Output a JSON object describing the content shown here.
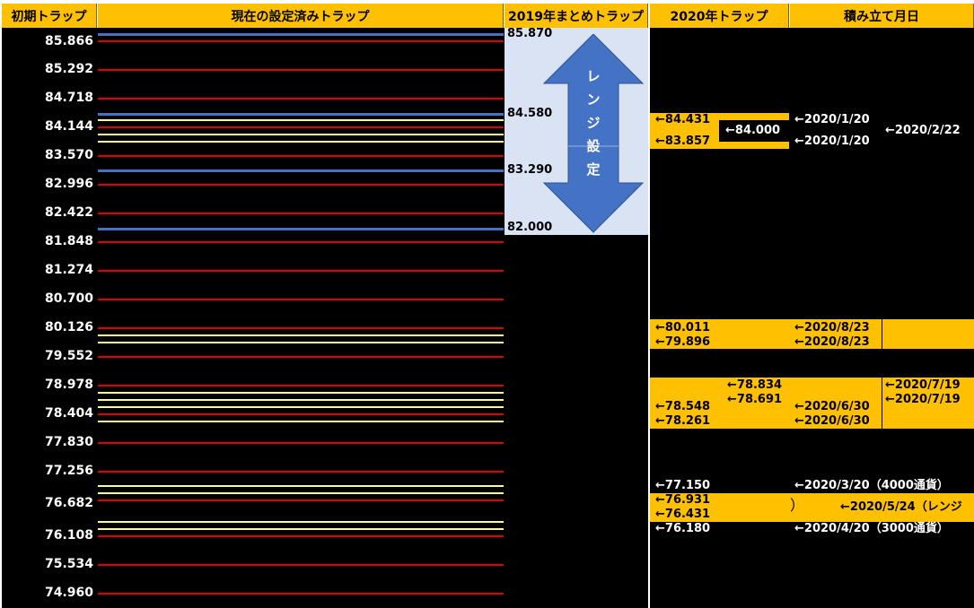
{
  "headers": {
    "col1": "初期トラップ",
    "col2": "現在の設定済みトラップ",
    "col3": "2019年まとめトラップ",
    "col4": "2020年トラップ",
    "col5": "積み立て月日"
  },
  "initial_prices": [
    "85.866",
    "85.292",
    "84.718",
    "84.144",
    "83.570",
    "82.996",
    "82.422",
    "81.848",
    "81.274",
    "80.700",
    "80.126",
    "79.552",
    "78.978",
    "78.404",
    "77.830",
    "77.256",
    "76.682",
    "76.108",
    "75.534",
    "74.960"
  ],
  "range_2019": {
    "values": [
      "85.870",
      "84.580",
      "83.290",
      "82.000"
    ],
    "arrow_label": "レンジ設定",
    "colors": {
      "panel": "#dae3f3",
      "arrow": "#4472c4"
    }
  },
  "traps_2020": {
    "group1": {
      "a": "←84.431",
      "b": "←83.857",
      "box": "←84.000",
      "d1": "←2020/1/20",
      "d2": "←2020/1/20",
      "d3": "←2020/2/22"
    },
    "group2": {
      "a": "←80.011",
      "b": "←79.896",
      "d1": "←2020/8/23",
      "d2": "←2020/8/23"
    },
    "group3": {
      "a": "←78.834",
      "b": "←78.691",
      "c": "←78.548",
      "d": "←78.261",
      "d1": "←2020/7/19",
      "d2": "←2020/7/19",
      "d3": "←2020/6/30",
      "d4": "←2020/6/30"
    },
    "group4": {
      "a": "←77.150",
      "b": "←76.931",
      "c": "←76.431",
      "d": "←76.180",
      "d1": "←2020/3/20（4000通貨）",
      "bracket": "）",
      "d2": "←2020/5/24（レンジ",
      "d3": "←2020/4/20（3000通貨）"
    }
  },
  "colors": {
    "red_line": "#e00000",
    "yellow_line": "#ffff80",
    "blue_line": "#4472c4",
    "highlight": "#ffc000"
  }
}
